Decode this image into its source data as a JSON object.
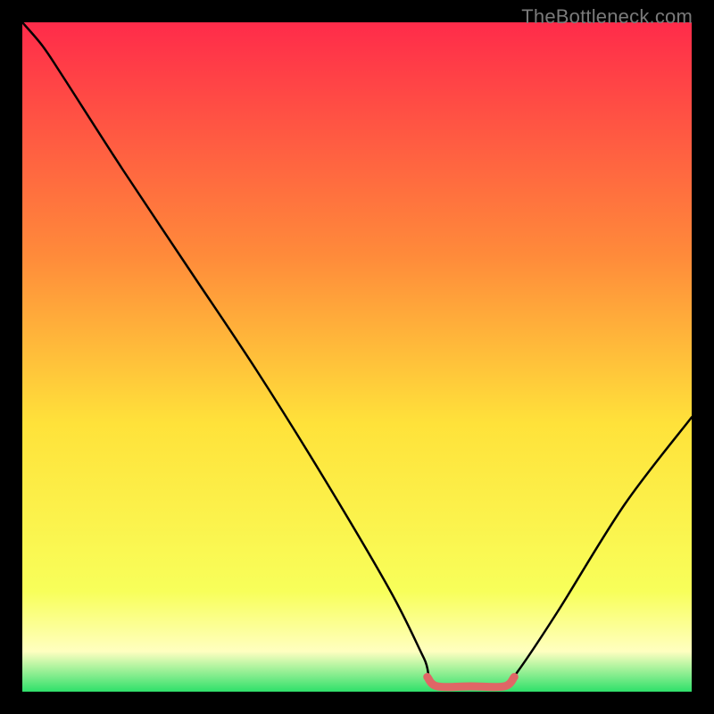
{
  "watermark": "TheBottleneck.com",
  "chart_data": {
    "type": "line",
    "title": "",
    "xlabel": "",
    "ylabel": "",
    "xlim": [
      0,
      100
    ],
    "ylim": [
      0,
      100
    ],
    "background": {
      "gradient_stops": [
        {
          "offset": 0,
          "color": "#ff2b4a"
        },
        {
          "offset": 35,
          "color": "#ff8b3a"
        },
        {
          "offset": 60,
          "color": "#ffe23a"
        },
        {
          "offset": 85,
          "color": "#f8ff5a"
        },
        {
          "offset": 94,
          "color": "#ffffc0"
        },
        {
          "offset": 100,
          "color": "#2fe06a"
        }
      ]
    },
    "series": [
      {
        "name": "bottleneck-curve",
        "color": "#000000",
        "points": [
          {
            "x": 0,
            "y": 100
          },
          {
            "x": 3,
            "y": 96.5
          },
          {
            "x": 6,
            "y": 92
          },
          {
            "x": 15,
            "y": 78
          },
          {
            "x": 25,
            "y": 63
          },
          {
            "x": 35,
            "y": 48
          },
          {
            "x": 45,
            "y": 32
          },
          {
            "x": 55,
            "y": 15
          },
          {
            "x": 60,
            "y": 5
          },
          {
            "x": 62,
            "y": 1
          },
          {
            "x": 72,
            "y": 1
          },
          {
            "x": 74,
            "y": 3
          },
          {
            "x": 80,
            "y": 12
          },
          {
            "x": 90,
            "y": 28
          },
          {
            "x": 100,
            "y": 41
          }
        ]
      }
    ],
    "highlight": {
      "name": "optimal-range",
      "color": "#e06666",
      "points": [
        {
          "x": 60.5,
          "y": 2.2
        },
        {
          "x": 62,
          "y": 0.8
        },
        {
          "x": 67,
          "y": 0.8
        },
        {
          "x": 72,
          "y": 0.8
        },
        {
          "x": 73.5,
          "y": 2.2
        }
      ]
    }
  }
}
